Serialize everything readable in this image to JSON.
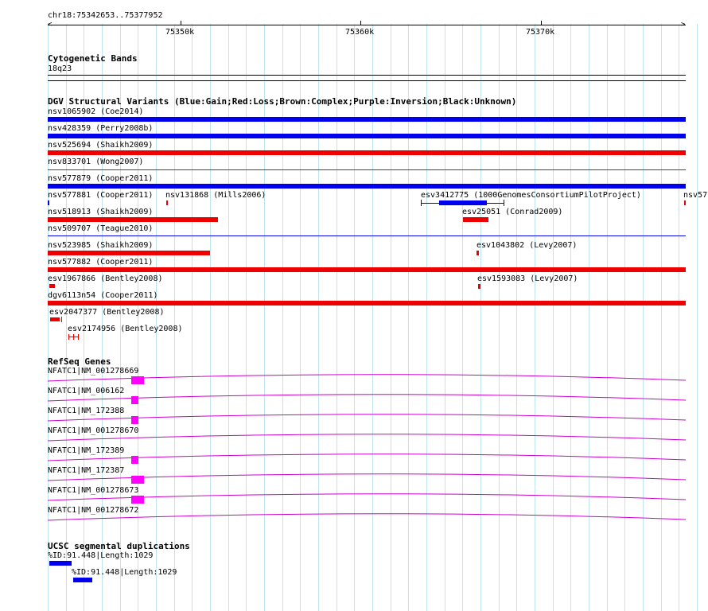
{
  "ruler": {
    "location": "chr18:75342653..75377952",
    "ticks": [
      "75350k",
      "75360k",
      "75370k"
    ]
  },
  "cytoband": {
    "title": "Cytogenetic Bands",
    "band": "18q23"
  },
  "dgv": {
    "title": "DGV Structural Variants (Blue:Gain;Red:Loss;Brown:Complex;Purple:Inversion;Black:Unknown)",
    "labels": {
      "nsv1065902": "nsv1065902 (Coe2014)",
      "nsv428359": "nsv428359 (Perry2008b)",
      "nsv525694": "nsv525694 (Shaikh2009)",
      "nsv833701": "nsv833701 (Wong2007)",
      "nsv577879": "nsv577879 (Cooper2011)",
      "nsv577881": "nsv577881 (Cooper2011)",
      "nsv131868": "nsv131868 (Mills2006)",
      "esv3412775": "esv3412775 (1000GenomesConsortiumPilotProject)",
      "nsv57_trunc": "nsv57",
      "nsv518913": "nsv518913 (Shaikh2009)",
      "esv25051": "esv25051 (Conrad2009)",
      "nsv509707": "nsv509707 (Teague2010)",
      "nsv523985": "nsv523985 (Shaikh2009)",
      "esv1043802": "esv1043802 (Levy2007)",
      "nsv577882": "nsv577882 (Cooper2011)",
      "esv1967866": "esv1967866 (Bentley2008)",
      "esv1593083": "esv1593083 (Levy2007)",
      "dgv6113n54": "dgv6113n54 (Cooper2011)",
      "esv2047377": "esv2047377 (Bentley2008)",
      "esv2174956": "esv2174956 (Bentley2008)"
    }
  },
  "refseq": {
    "title": "RefSeq Genes",
    "transcripts": [
      "NFATC1|NM_001278669",
      "NFATC1|NM_006162",
      "NFATC1|NM_172388",
      "NFATC1|NM_001278670",
      "NFATC1|NM_172389",
      "NFATC1|NM_172387",
      "NFATC1|NM_001278673",
      "NFATC1|NM_001278672"
    ]
  },
  "segdups": {
    "title": "UCSC segmental duplications",
    "items": [
      "%ID:91.448|Length:1029",
      "%ID:91.448|Length:1029"
    ]
  },
  "colors": {
    "gain": "#0000ee",
    "loss": "#ee0000",
    "gene": "#cc00cc",
    "exon": "#ff00ff",
    "segdup": "#0000ee",
    "grid": "#bfe4ef"
  }
}
